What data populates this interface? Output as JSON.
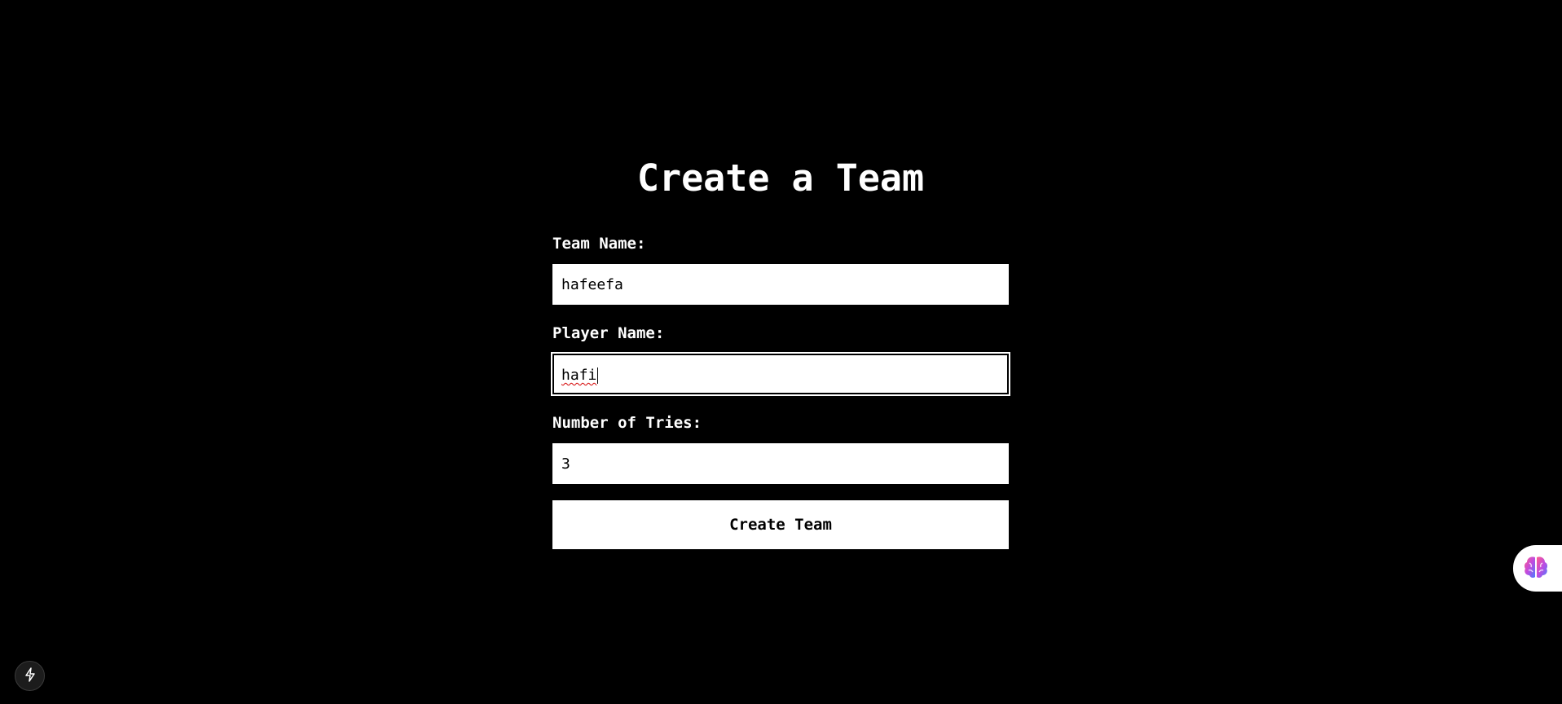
{
  "form": {
    "title": "Create a Team",
    "team_name": {
      "label": "Team Name:",
      "value": "hafeefa"
    },
    "player_name": {
      "label": "Player Name:",
      "value": "hafi"
    },
    "tries": {
      "label": "Number of Tries:",
      "value": "3"
    },
    "submit_label": "Create Team"
  },
  "icons": {
    "side_widget": "brain-icon",
    "corner_button": "lightning-bolt-icon"
  },
  "colors": {
    "background": "#000000",
    "foreground": "#ffffff",
    "input_bg": "#ffffff",
    "input_text": "#000000"
  }
}
